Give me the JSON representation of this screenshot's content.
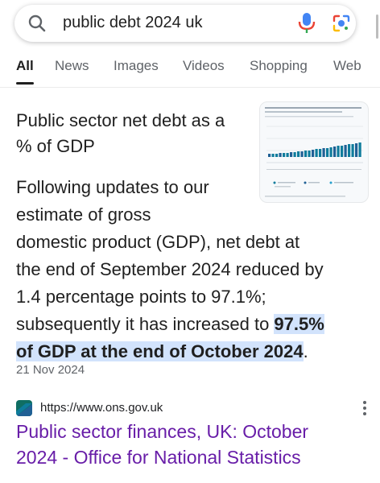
{
  "search": {
    "query": "public debt 2024 uk",
    "icons": [
      "search-icon",
      "mic-icon",
      "google-lens-icon"
    ]
  },
  "tabs": [
    {
      "label": "All",
      "active": true
    },
    {
      "label": "News"
    },
    {
      "label": "Images"
    },
    {
      "label": "Videos"
    },
    {
      "label": "Shopping"
    },
    {
      "label": "Web"
    }
  ],
  "snippet": {
    "title_lines": [
      "Public sector net debt as a",
      "% of GDP"
    ],
    "body_lines": [
      "Following updates to our",
      "estimate of gross",
      "domestic product (GDP), net debt at",
      "the end of September 2024 reduced by",
      "1.4 percentage points to 97.1%;"
    ],
    "line6_plain": "subsequently it has increased to ",
    "line6_highlight": "97.5%",
    "line7_highlight": "of GDP at the end of October 2024",
    "line7_tail": ".",
    "date": "21 Nov 2024"
  },
  "result": {
    "url": "https://www.ons.gov.uk",
    "title_lines": [
      "Public sector finances, UK: October",
      "2024 - Office for National Statistics"
    ],
    "icons": [
      "ons-favicon",
      "more-options-icon"
    ]
  },
  "colors": {
    "link": "#681da8",
    "highlight": "#d2e3fc",
    "secondary_text": "#5f6368",
    "chart_teal": "#0e7c9c"
  }
}
